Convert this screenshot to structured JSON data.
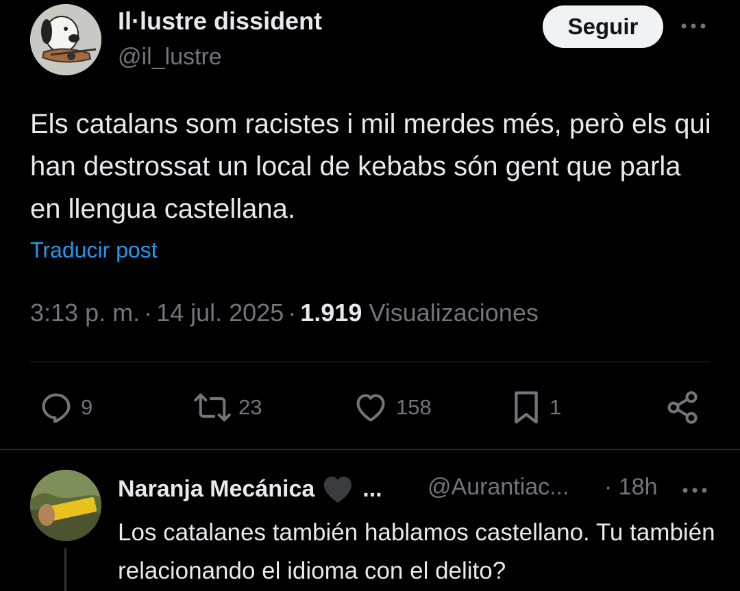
{
  "post": {
    "author": {
      "name": "Il·lustre dissident",
      "handle": "@il_lustre",
      "avatar_icon": "snoopy-guitar-avatar"
    },
    "follow_label": "Seguir",
    "more_icon": "more-horizontal-icon",
    "text": "Els catalans som racistes i mil merdes més, però els qui han destrossat un local de kebabs són gent que parla en llengua castellana.",
    "translate_label": "Traducir post",
    "meta": {
      "time": "3:13 p. m.",
      "separator": "·",
      "date": "14 jul. 2025",
      "views_count": "1.919",
      "views_label": "Visualizaciones"
    },
    "actions": {
      "replies": {
        "icon": "reply-icon",
        "count": "9"
      },
      "reposts": {
        "icon": "repost-icon",
        "count": "23"
      },
      "likes": {
        "icon": "like-icon",
        "count": "158"
      },
      "bookmarks": {
        "icon": "bookmark-icon",
        "count": "1"
      },
      "share": {
        "icon": "share-icon"
      }
    }
  },
  "reply": {
    "author": {
      "name": "Naranja Mecánica",
      "badge_icon": "heart-icon",
      "ellipsis": "...",
      "handle": "@Aurantiac...",
      "avatar_icon": "photo-avatar"
    },
    "time": "· 18h",
    "text": "Los catalanes también hablamos castellano. Tu también relacionando el idioma con el delito?"
  },
  "colors": {
    "background": "#000000",
    "text_primary": "#e7e9ea",
    "text_secondary": "#71767b",
    "link": "#1d9bf0",
    "divider": "#2f3336",
    "follow_button_bg": "#eff3f4"
  }
}
